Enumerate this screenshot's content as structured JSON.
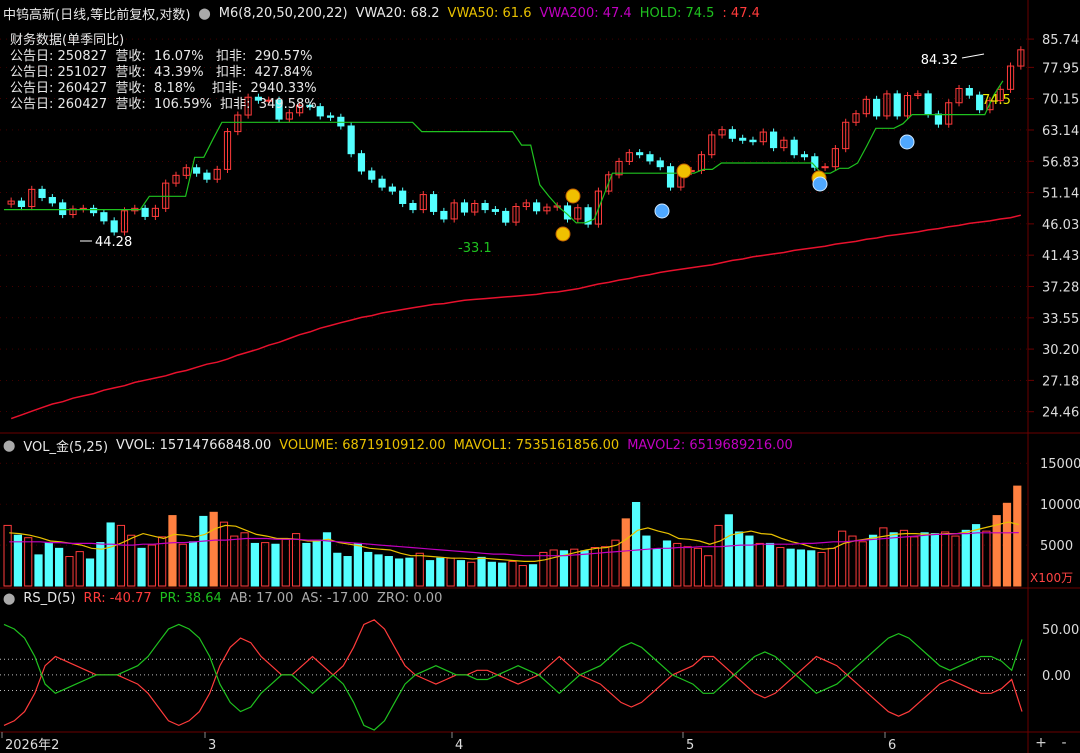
{
  "header": {
    "stock_name": "中钨高新(日线,等比前复权,对数)",
    "ma_indicator": "M6(8,20,50,200,22)",
    "vwa20": "VWA20: 68.2",
    "vwa50": "VWA50: 61.6",
    "vwa200": "VWA200: 47.4",
    "hold": "HOLD: 74.5",
    "hold_extra": ": 47.4"
  },
  "financial": {
    "title": "财务数据(单季同比)",
    "rows": [
      "公告日: 250827  营收:  16.07%   扣非:  290.57%",
      "公告日: 251027  营收:  43.39%   扣非:  427.84%",
      "公告日: 260427  营收:  8.18%    扣非:  2940.33%",
      "公告日: 260427  营收:  106.59%  扣非:  349.58%"
    ]
  },
  "annotations": {
    "high": "84.32",
    "low": "44.28",
    "hold_value": "74.5",
    "hold_low": "-33.1"
  },
  "volume_header": {
    "name": "VOL_金(5,25)",
    "vvol": "VVOL: 15714766848.00",
    "volume": "VOLUME: 6871910912.00",
    "mavol1": "MAVOL1: 7535161856.00",
    "mavol2": "MAVOL2: 6519689216.00"
  },
  "rs_header": {
    "name": "RS_D(5)",
    "rr": "RR: -40.77",
    "pr": "PR: 38.64",
    "ab": "AB: 17.00",
    "as": "AS: -17.00",
    "zro": "ZRO: 0.00"
  },
  "controls": {
    "plus": "+",
    "minus": "-"
  },
  "colors": {
    "up": "#ff3b3b",
    "down": "#54ffff",
    "hold": "#1fc21f",
    "ma_long": "#e8112d",
    "magenta": "#c000c0",
    "yellow": "#e8c000",
    "grid": "#6a0000"
  },
  "chart_data": [
    {
      "type": "candlestick",
      "title": "中钨高新(日线,等比前复权,对数)",
      "y_scale": "log",
      "ylim": [
        23.0,
        89.0
      ],
      "y_ticks": [
        "85.74",
        "77.95",
        "70.15",
        "63.14",
        "56.83",
        "51.14",
        "46.03",
        "41.43",
        "37.28",
        "33.55",
        "30.20",
        "27.18",
        "24.46"
      ],
      "x_ticks": [
        "2026年2",
        "3",
        "4",
        "5",
        "6"
      ],
      "close": [
        49.7,
        48.8,
        51.7,
        50.3,
        49.4,
        47.5,
        48.4,
        48.5,
        47.8,
        46.5,
        44.8,
        48.1,
        48.5,
        47.2,
        48.5,
        52.8,
        54.2,
        55.6,
        54.6,
        53.5,
        55.3,
        62.8,
        66.4,
        70.5,
        69.8,
        69.8,
        65.5,
        66.9,
        68.6,
        68.3,
        66.2,
        65.9,
        64.0,
        58.3,
        55.0,
        53.5,
        52.1,
        51.4,
        49.3,
        48.3,
        50.8,
        48.0,
        46.8,
        49.4,
        47.9,
        49.3,
        48.3,
        48.0,
        46.3,
        48.8,
        49.4,
        48.1,
        48.7,
        48.9,
        46.8,
        48.6,
        46.0,
        51.4,
        54.3,
        56.8,
        58.5,
        58.1,
        56.9,
        55.8,
        52.1,
        54.9,
        55.1,
        58.1,
        62.1,
        63.2,
        61.4,
        61.0,
        60.7,
        62.7,
        59.5,
        61.0,
        58.1,
        57.7,
        55.7,
        55.8,
        59.3,
        64.8,
        66.7,
        70.0,
        66.2,
        71.3,
        66.2,
        70.9,
        71.3,
        66.6,
        64.4,
        69.2,
        72.6,
        71.0,
        67.6,
        69.7,
        72.4,
        78.3,
        82.7
      ],
      "ma_long": [
        23.9,
        24.2,
        24.5,
        24.8,
        25.1,
        25.3,
        25.6,
        25.8,
        26.0,
        26.3,
        26.5,
        26.7,
        27.0,
        27.2,
        27.4,
        27.6,
        27.9,
        28.1,
        28.4,
        28.7,
        28.9,
        29.2,
        29.6,
        29.9,
        30.2,
        30.6,
        30.9,
        31.3,
        31.7,
        32.0,
        32.4,
        32.7,
        33.0,
        33.3,
        33.6,
        33.8,
        34.1,
        34.3,
        34.5,
        34.7,
        34.9,
        35.1,
        35.2,
        35.4,
        35.6,
        35.7,
        35.8,
        35.9,
        36.0,
        36.1,
        36.2,
        36.3,
        36.5,
        36.6,
        36.8,
        37.0,
        37.3,
        37.6,
        37.8,
        38.1,
        38.3,
        38.6,
        38.8,
        39.1,
        39.3,
        39.5,
        39.7,
        39.9,
        40.1,
        40.4,
        40.7,
        40.9,
        41.2,
        41.4,
        41.6,
        41.8,
        42.1,
        42.3,
        42.5,
        42.7,
        43.0,
        43.2,
        43.4,
        43.7,
        43.9,
        44.2,
        44.4,
        44.6,
        44.8,
        45.1,
        45.3,
        45.6,
        45.8,
        46.1,
        46.3,
        46.5,
        46.8,
        47.0,
        47.4
      ],
      "hold_line": [
        48.3,
        48.3,
        48.3,
        48.3,
        48.3,
        48.3,
        48.3,
        48.3,
        48.3,
        48.3,
        48.3,
        48.3,
        48.3,
        48.3,
        48.3,
        48.3,
        50.5,
        50.5,
        50.5,
        50.5,
        50.5,
        57.6,
        57.6,
        61.2,
        64.8,
        64.8,
        64.8,
        64.8,
        64.8,
        64.8,
        64.8,
        64.8,
        64.8,
        64.8,
        64.8,
        64.8,
        64.8,
        64.8,
        64.8,
        64.8,
        64.8,
        64.8,
        64.8,
        64.8,
        64.8,
        64.8,
        62.8,
        62.8,
        62.8,
        62.8,
        62.8,
        62.8,
        62.8,
        62.8,
        62.8,
        62.8,
        62.8,
        60.0,
        60.0,
        52.5,
        50.5,
        48.8,
        47.6,
        46.2,
        46.2,
        46.8,
        50.5,
        54.6,
        54.6,
        54.6,
        54.6,
        54.6,
        54.6,
        54.6,
        54.6,
        54.6,
        54.6,
        55.3,
        55.3,
        56.5,
        56.5,
        56.5,
        56.5,
        56.5,
        56.5,
        56.5,
        56.5,
        56.5,
        56.5,
        56.5,
        54.6,
        54.6,
        55.5,
        55.5,
        56.5,
        59.8,
        63.5,
        63.5,
        63.5,
        64.5,
        66.5,
        66.5,
        66.5,
        66.5,
        66.5,
        66.5,
        66.5,
        66.5,
        66.5,
        71.0,
        74.5
      ]
    },
    {
      "type": "bar",
      "title": "VOL_金(5,25)",
      "unit": "X100万",
      "y_ticks": [
        5000,
        10000,
        15000
      ],
      "ylim": [
        0,
        16000
      ],
      "values": [
        7400,
        6200,
        5900,
        3800,
        5300,
        4600,
        3600,
        4200,
        3300,
        5300,
        7700,
        7400,
        6200,
        4600,
        5000,
        6000,
        8600,
        5100,
        5400,
        8500,
        9000,
        7800,
        6100,
        6500,
        5200,
        5300,
        5100,
        5700,
        6400,
        5200,
        5600,
        6500,
        4000,
        3600,
        5200,
        4100,
        3800,
        3600,
        3300,
        3400,
        4000,
        3100,
        3400,
        3400,
        3100,
        2900,
        3500,
        2900,
        2800,
        3000,
        2500,
        2600,
        4100,
        4400,
        4300,
        4500,
        4300,
        4700,
        4800,
        5600,
        8200,
        10200,
        6100,
        4500,
        5500,
        5200,
        4800,
        4600,
        3700,
        7400,
        8700,
        6600,
        6100,
        5200,
        5200,
        4700,
        4500,
        4400,
        4300,
        4100,
        4600,
        6700,
        6100,
        5400,
        6200,
        7100,
        6500,
        6800,
        6000,
        6500,
        6400,
        6600,
        6100,
        6800,
        7500,
        6700,
        8600,
        10100,
        12200
      ],
      "mavol1": [
        6500,
        6400,
        6200,
        5900,
        5500,
        5400,
        5200,
        5000,
        4600,
        4500,
        4800,
        5300,
        5900,
        6400,
        6100,
        5800,
        6300,
        6200,
        6000,
        6300,
        7000,
        7400,
        7300,
        6800,
        6300,
        6100,
        5800,
        5800,
        5700,
        5500,
        5500,
        5700,
        5300,
        5100,
        4900,
        4600,
        4500,
        4400,
        4000,
        3700,
        3700,
        3600,
        3500,
        3400,
        3400,
        3300,
        3400,
        3300,
        3200,
        3100,
        3000,
        3000,
        3200,
        3500,
        3800,
        4100,
        4400,
        4600,
        4700,
        5000,
        5800,
        6800,
        7100,
        6700,
        6400,
        5800,
        5700,
        5500,
        5100,
        5500,
        6200,
        6500,
        6700,
        6400,
        6300,
        5800,
        5400,
        5100,
        4700,
        4500,
        4600,
        5200,
        5500,
        5700,
        5900,
        6100,
        6300,
        6400,
        6400,
        6300,
        6300,
        6400,
        6400,
        6600,
        6900,
        7200,
        7500,
        7800,
        7500
      ],
      "mavol2": [
        5400,
        5400,
        5400,
        5400,
        5300,
        5300,
        5200,
        5200,
        5200,
        5100,
        5100,
        5000,
        5000,
        5100,
        5100,
        5200,
        5300,
        5300,
        5400,
        5500,
        5600,
        5600,
        5700,
        5800,
        5800,
        5800,
        5700,
        5700,
        5700,
        5600,
        5600,
        5500,
        5400,
        5300,
        5200,
        5100,
        5000,
        4900,
        4800,
        4700,
        4600,
        4500,
        4400,
        4300,
        4200,
        4100,
        4000,
        3900,
        3900,
        3800,
        3700,
        3700,
        3700,
        3700,
        3700,
        3800,
        3900,
        4000,
        4100,
        4200,
        4300,
        4400,
        4500,
        4600,
        4600,
        4700,
        4700,
        4800,
        4800,
        4800,
        4900,
        5000,
        5000,
        5100,
        5100,
        5100,
        5100,
        5200,
        5200,
        5300,
        5400,
        5400,
        5500,
        5600,
        5700,
        5800,
        5900,
        6000,
        6100,
        6200,
        6300,
        6300,
        6400,
        6400,
        6500,
        6500,
        6500,
        6500,
        6519
      ]
    },
    {
      "type": "line",
      "title": "RS_D(5)",
      "y_ticks": [
        50.0,
        0.0
      ],
      "ylim": [
        -60,
        75
      ],
      "reference_lines": [
        17,
        0,
        -17
      ],
      "series": [
        {
          "name": "RR",
          "values": [
            -55,
            -50,
            -40,
            -20,
            10,
            20,
            15,
            10,
            5,
            0,
            0,
            0,
            -5,
            -10,
            -20,
            -35,
            -50,
            -55,
            -50,
            -40,
            -20,
            10,
            30,
            40,
            35,
            20,
            10,
            0,
            0,
            10,
            20,
            10,
            0,
            10,
            30,
            55,
            60,
            50,
            30,
            10,
            0,
            -5,
            -10,
            -5,
            0,
            0,
            5,
            5,
            0,
            -5,
            -10,
            -5,
            0,
            10,
            20,
            10,
            0,
            -5,
            -10,
            -20,
            -30,
            -35,
            -30,
            -20,
            -10,
            0,
            5,
            10,
            20,
            20,
            10,
            0,
            -10,
            -20,
            -25,
            -20,
            -10,
            0,
            10,
            20,
            15,
            10,
            0,
            -10,
            -20,
            -30,
            -40,
            -45,
            -40,
            -30,
            -20,
            -10,
            -5,
            -10,
            -15,
            -20,
            -20,
            -15,
            -5,
            -40
          ]
        },
        {
          "name": "PR",
          "values": [
            55,
            50,
            40,
            20,
            -10,
            -20,
            -15,
            -10,
            -5,
            0,
            0,
            0,
            5,
            10,
            20,
            35,
            50,
            55,
            50,
            40,
            20,
            -10,
            -30,
            -40,
            -35,
            -20,
            -10,
            0,
            0,
            -10,
            -20,
            -10,
            0,
            -10,
            -30,
            -55,
            -60,
            -50,
            -30,
            -10,
            0,
            5,
            10,
            5,
            0,
            0,
            -5,
            -5,
            0,
            5,
            10,
            5,
            0,
            -10,
            -20,
            -10,
            0,
            5,
            10,
            20,
            30,
            35,
            30,
            20,
            10,
            0,
            -5,
            -10,
            -20,
            -20,
            -10,
            0,
            10,
            20,
            25,
            20,
            10,
            0,
            -10,
            -20,
            -15,
            -10,
            0,
            10,
            20,
            30,
            40,
            45,
            40,
            30,
            20,
            10,
            5,
            10,
            15,
            20,
            20,
            15,
            5,
            38.64
          ]
        }
      ]
    }
  ]
}
